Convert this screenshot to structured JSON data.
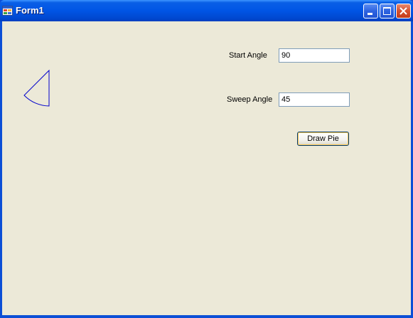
{
  "window": {
    "title": "Form1"
  },
  "form": {
    "start_angle": {
      "label": "Start Angle",
      "value": "90"
    },
    "sweep_angle": {
      "label": "Sweep Angle",
      "value": "45"
    },
    "draw_button_label": "Draw Pie"
  },
  "colors": {
    "pie_outline": "#0000cc",
    "client_bg": "#ece9d8"
  }
}
